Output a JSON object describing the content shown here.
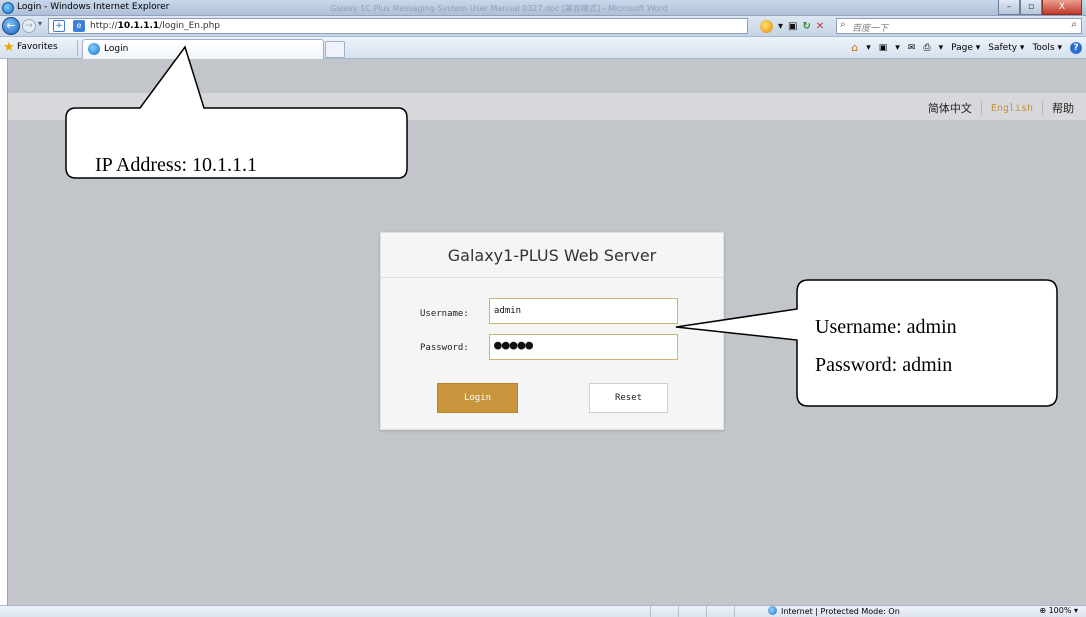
{
  "window": {
    "title": "Login - Windows Internet Explorer",
    "blurred_title": "Galaxy 1C Plus Messaging System User Manual 0327.doc [兼容模式] - Microsoft Word",
    "buttons": {
      "minimize": "–",
      "maximize": "▫",
      "close": "X"
    }
  },
  "navigation": {
    "url_prefix": "http://",
    "url_host": "10.1.1.1",
    "url_path": "/login_En.php",
    "search_placeholder": "百度一下"
  },
  "favorites": {
    "label": "Favorites",
    "tab_label": "Login",
    "commands": [
      "Page ▾",
      "Safety ▾",
      "Tools ▾"
    ]
  },
  "language_bar": {
    "chinese": "简体中文",
    "english": "English",
    "help": "帮助"
  },
  "login": {
    "title": "Galaxy1-PLUS Web Server",
    "username_label": "Username:",
    "username_value": "admin",
    "password_label": "Password:",
    "password_mask": "●●●●●",
    "login_button": "Login",
    "reset_button": "Reset"
  },
  "status_bar": {
    "zone": "Internet | Protected Mode: On",
    "zoom": "100%"
  },
  "callouts": {
    "ip": "IP Address: 10.1.1.1",
    "username": "Username: admin",
    "password": "Password: admin"
  },
  "colors": {
    "accent_gold": "#c8943c",
    "page_bg": "#c2c5c9",
    "card_bg": "#f5f5f5"
  }
}
